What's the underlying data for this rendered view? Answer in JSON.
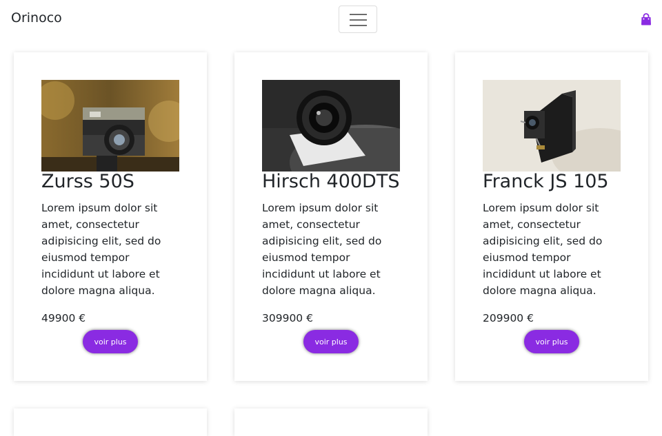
{
  "navbar": {
    "brand": "Orinoco",
    "toggler_icon": "hamburger-menu-icon",
    "cart_icon": "shopping-bag-icon",
    "accent_color": "#8a2be2"
  },
  "products": [
    {
      "name": "Zurss 50S",
      "description": "Lorem ipsum dolor sit amet, consectetur adipisicing elit, sed do eiusmod tempor incididunt ut labore et dolore magna aliqua.",
      "price": "49900 €",
      "button_label": "voir plus"
    },
    {
      "name": "Hirsch 400DTS",
      "description": "Lorem ipsum dolor sit amet, consectetur adipisicing elit, sed do eiusmod tempor incididunt ut labore et dolore magna aliqua.",
      "price": "309900 €",
      "button_label": "voir plus"
    },
    {
      "name": "Franck JS 105",
      "description": "Lorem ipsum dolor sit amet, consectetur adipisicing elit, sed do eiusmod tempor incididunt ut labore et dolore magna aliqua.",
      "price": "209900 €",
      "button_label": "voir plus"
    }
  ]
}
